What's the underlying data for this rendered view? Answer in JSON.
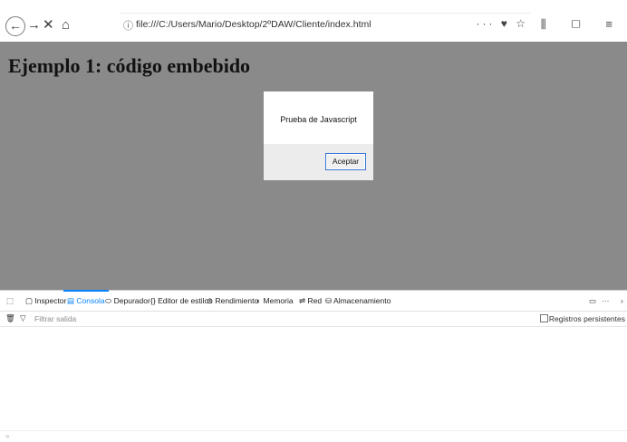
{
  "browser": {
    "url": "file:///C:/Users/Mario/Desktop/2ºDAW/Cliente/index.html",
    "nav": {
      "back": "←",
      "forward": "→",
      "stop": "✕",
      "home": "⌂"
    },
    "url_icons": "··· ♥ ☆",
    "right_icons": "⫼ ▢ ≡"
  },
  "page": {
    "heading": "Ejemplo 1: código embebido",
    "overlay_color": "#8a8a8a"
  },
  "dialog": {
    "message": "Prueba de Javascript",
    "ok_label": "Aceptar"
  },
  "devtools": {
    "tabs": [
      {
        "label": "Inspector",
        "icon": "inspector-icon"
      },
      {
        "label": "Consola",
        "icon": "console-icon"
      },
      {
        "label": "Depurador",
        "icon": "debugger-icon"
      },
      {
        "label": "Editor de estilos",
        "icon": "style-editor-icon"
      },
      {
        "label": "Rendimiento",
        "icon": "performance-icon"
      },
      {
        "label": "Memoria",
        "icon": "memory-icon"
      },
      {
        "label": "Red",
        "icon": "network-icon"
      },
      {
        "label": "Almacenamiento",
        "icon": "storage-icon"
      }
    ],
    "active_tab": "Consola",
    "filter_placeholder": "Filtrar salida",
    "persist_logs": "Registros persistentes",
    "accent": "#0a84ff"
  }
}
